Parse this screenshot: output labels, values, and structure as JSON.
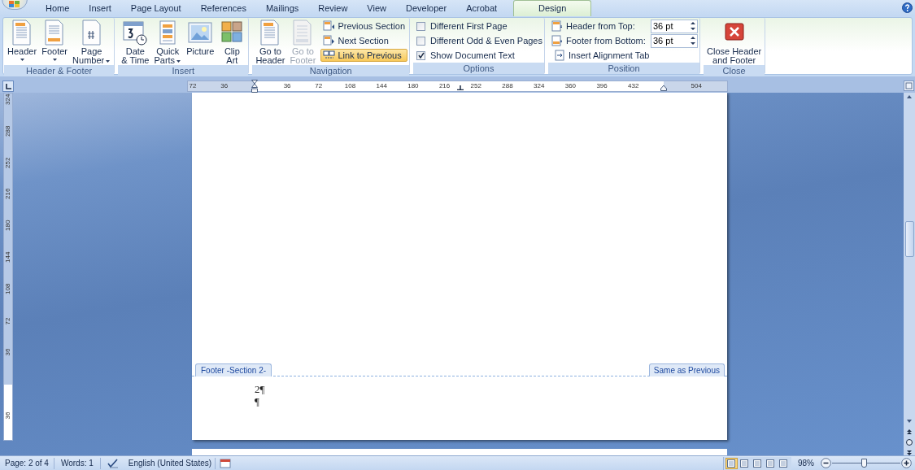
{
  "tabs": [
    {
      "label": "Home",
      "selected": false
    },
    {
      "label": "Insert",
      "selected": false
    },
    {
      "label": "Page Layout",
      "selected": false
    },
    {
      "label": "References",
      "selected": false
    },
    {
      "label": "Mailings",
      "selected": false
    },
    {
      "label": "Review",
      "selected": false
    },
    {
      "label": "View",
      "selected": false
    },
    {
      "label": "Developer",
      "selected": false
    },
    {
      "label": "Acrobat",
      "selected": false
    },
    {
      "label": "Design",
      "selected": true
    }
  ],
  "ribbon_groups": [
    {
      "label": "Header & Footer",
      "items": [
        {
          "kind": "large",
          "lines": [
            "Header"
          ],
          "dropdown": true,
          "disabled": false
        },
        {
          "kind": "large",
          "lines": [
            "Footer"
          ],
          "dropdown": true,
          "disabled": false
        },
        {
          "kind": "large",
          "lines": [
            "Page",
            "Number"
          ],
          "dropdown": true,
          "disabled": false
        }
      ]
    },
    {
      "label": "Insert",
      "items": [
        {
          "kind": "large",
          "lines": [
            "Date",
            "& Time"
          ],
          "dropdown": false,
          "disabled": false
        },
        {
          "kind": "large",
          "lines": [
            "Quick",
            "Parts"
          ],
          "dropdown": true,
          "disabled": false
        },
        {
          "kind": "large",
          "lines": [
            "Picture"
          ],
          "dropdown": false,
          "disabled": false
        },
        {
          "kind": "large",
          "lines": [
            "Clip",
            "Art"
          ],
          "dropdown": false,
          "disabled": false
        }
      ]
    },
    {
      "label": "Navigation",
      "items": [
        {
          "kind": "large",
          "lines": [
            "Go to",
            "Header"
          ],
          "dropdown": false,
          "disabled": false
        },
        {
          "kind": "large",
          "lines": [
            "Go to",
            "Footer"
          ],
          "dropdown": false,
          "disabled": true
        },
        {
          "kind": "small",
          "label": "Previous Section",
          "active": false
        },
        {
          "kind": "small",
          "label": "Next Section",
          "active": false
        },
        {
          "kind": "small",
          "label": "Link to Previous",
          "active": true
        }
      ]
    },
    {
      "label": "Options",
      "items": [
        {
          "kind": "checkbox",
          "label": "Different First Page",
          "checked": false
        },
        {
          "kind": "checkbox",
          "label": "Different Odd & Even Pages",
          "checked": false
        },
        {
          "kind": "checkbox",
          "label": "Show Document Text",
          "checked": true
        }
      ]
    },
    {
      "label": "Position",
      "items": [
        {
          "kind": "spinner",
          "label": "Header from Top:",
          "value": "36 pt"
        },
        {
          "kind": "spinner",
          "label": "Footer from Bottom:",
          "value": "36 pt"
        },
        {
          "kind": "small",
          "label": "Insert Alignment Tab",
          "active": false
        }
      ]
    },
    {
      "label": "Close",
      "items": [
        {
          "kind": "large",
          "lines": [
            "Close Header",
            "and Footer"
          ],
          "dropdown": false,
          "disabled": false
        }
      ]
    }
  ],
  "ruler": {
    "labels": [
      "72",
      "36",
      "36",
      "72",
      "108",
      "144",
      "180",
      "216",
      "252",
      "288",
      "324",
      "360",
      "396",
      "432",
      "504"
    ]
  },
  "vertical_ruler": {
    "top_labels": [
      "324",
      "288",
      "252",
      "216",
      "180",
      "144",
      "108",
      "72",
      "36"
    ],
    "bottom_labels": [
      "36"
    ]
  },
  "document": {
    "footer_tab": "Footer -Section 2-",
    "link_tab": "Same as Previous",
    "footer_lines": [
      "2¶",
      "¶"
    ]
  },
  "status_bar": {
    "page": "Page: 2 of 4",
    "words": "Words: 1",
    "language": "English (United States)",
    "view_buttons": [
      {
        "selected": true
      },
      {
        "selected": false
      },
      {
        "selected": false
      },
      {
        "selected": false
      },
      {
        "selected": false
      }
    ],
    "zoom": "98%",
    "zoom_slider": {
      "level": 0.47
    }
  }
}
